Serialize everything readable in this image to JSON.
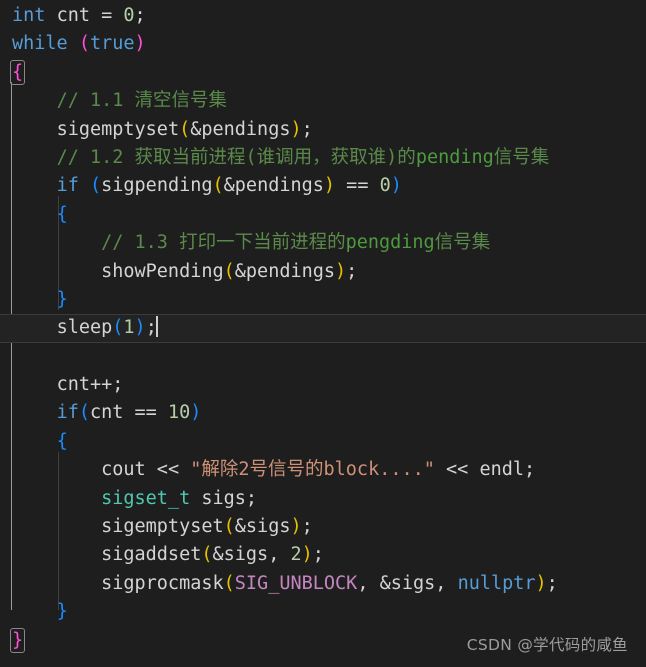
{
  "editor": {
    "background_color": "#1e1e1e",
    "foreground_color": "#d4d4d4",
    "language": "C++",
    "current_line_number": 12,
    "theme_colors": {
      "keyword": "#569cd6",
      "number": "#b5cea8",
      "string": "#ce9178",
      "comment": "#5a8a4a",
      "type": "#4ec9b0",
      "macro": "#c586c0",
      "bracket_level_0": "#ff4fd8",
      "bracket_level_1": "#1a8cff",
      "bracket_level_2": "#e5c100",
      "current_line_bg": "#232323",
      "indent_guide": "#404040",
      "indent_guide_active": "#9a9a9a",
      "watermark": "#9d9d9d"
    },
    "lines": [
      {
        "n": 1,
        "text": "int cnt = 0;"
      },
      {
        "n": 2,
        "text": "while (true)"
      },
      {
        "n": 3,
        "text": "{"
      },
      {
        "n": 4,
        "text": "    // 1.1 清空信号集"
      },
      {
        "n": 5,
        "text": "    sigemptyset(&pendings);"
      },
      {
        "n": 6,
        "text": "    // 1.2 获取当前进程(谁调用，获取谁)的pending信号集"
      },
      {
        "n": 7,
        "text": "    if (sigpending(&pendings) == 0)"
      },
      {
        "n": 8,
        "text": "    {"
      },
      {
        "n": 9,
        "text": "        // 1.3 打印一下当前进程的pengding信号集"
      },
      {
        "n": 10,
        "text": "        showPending(&pendings);"
      },
      {
        "n": 11,
        "text": "    }"
      },
      {
        "n": 12,
        "text": "    sleep(1);"
      },
      {
        "n": 13,
        "text": ""
      },
      {
        "n": 14,
        "text": "    cnt++;"
      },
      {
        "n": 15,
        "text": "    if(cnt == 10)"
      },
      {
        "n": 16,
        "text": "    {"
      },
      {
        "n": 17,
        "text": "        cout << \"解除2号信号的block....\" << endl;"
      },
      {
        "n": 18,
        "text": "        sigset_t sigs;"
      },
      {
        "n": 19,
        "text": "        sigemptyset(&sigs);"
      },
      {
        "n": 20,
        "text": "        sigaddset(&sigs, 2);"
      },
      {
        "n": 21,
        "text": "        sigprocmask(SIG_UNBLOCK, &sigs, nullptr);"
      },
      {
        "n": 22,
        "text": "    }"
      },
      {
        "n": 23,
        "text": "}"
      }
    ],
    "tokens": {
      "l1": {
        "kw": "int",
        "ident": "cnt",
        "op": "=",
        "num": "0",
        "semi": ";"
      },
      "l2": {
        "kw": "while",
        "paren_open": "(",
        "kw2": "true",
        "paren_close": ")"
      },
      "l3": {
        "brace": "{"
      },
      "l4": {
        "comment": "// 1.1 清空信号集"
      },
      "l5": {
        "fn": "sigemptyset",
        "open": "(",
        "arg": "&pendings",
        "close": ")",
        "semi": ";"
      },
      "l6": {
        "comment_pre": "// 1.2 获取当前进程(谁调用，获取谁)的",
        "comment_ascii": "pending",
        "comment_post": "信号集"
      },
      "l7": {
        "kw": "if",
        "sp": " ",
        "open": "(",
        "fn": "sigpending",
        "open2": "(",
        "arg": "&pendings",
        "close2": ")",
        "op": " == ",
        "num": "0",
        "close": ")"
      },
      "l8": {
        "brace": "{"
      },
      "l9": {
        "comment_pre": "// 1.3 打印一下当前进程的",
        "comment_ascii": "pengding",
        "comment_post": "信号集"
      },
      "l10": {
        "fn": "showPending",
        "open": "(",
        "arg": "&pendings",
        "close": ")",
        "semi": ";"
      },
      "l11": {
        "brace": "}"
      },
      "l12": {
        "fn": "sleep",
        "open": "(",
        "num": "1",
        "close": ")",
        "semi": ";"
      },
      "l14": {
        "ident": "cnt",
        "op": "++",
        "semi": ";"
      },
      "l15": {
        "kw": "if",
        "open": "(",
        "ident": "cnt",
        "op": " == ",
        "num": "10",
        "close": ")"
      },
      "l16": {
        "brace": "{"
      },
      "l17": {
        "ident": "cout",
        "op": " << ",
        "str": "\"解除2号信号的block....\"",
        "op2": " << ",
        "ident2": "endl",
        "semi": ";"
      },
      "l18": {
        "type": "sigset_t",
        "ident": "sigs",
        "semi": ";"
      },
      "l19": {
        "fn": "sigemptyset",
        "open": "(",
        "arg": "&sigs",
        "close": ")",
        "semi": ";"
      },
      "l20": {
        "fn": "sigaddset",
        "open": "(",
        "arg": "&sigs, ",
        "num": "2",
        "close": ")",
        "semi": ";"
      },
      "l21": {
        "fn": "sigprocmask",
        "open": "(",
        "macro": "SIG_UNBLOCK",
        "arg": ", &sigs, ",
        "kw": "nullptr",
        "close": ")",
        "semi": ";"
      },
      "l22": {
        "brace": "}"
      },
      "l23": {
        "brace": "}"
      }
    }
  },
  "watermark": {
    "text": "CSDN @学代码的咸鱼"
  }
}
